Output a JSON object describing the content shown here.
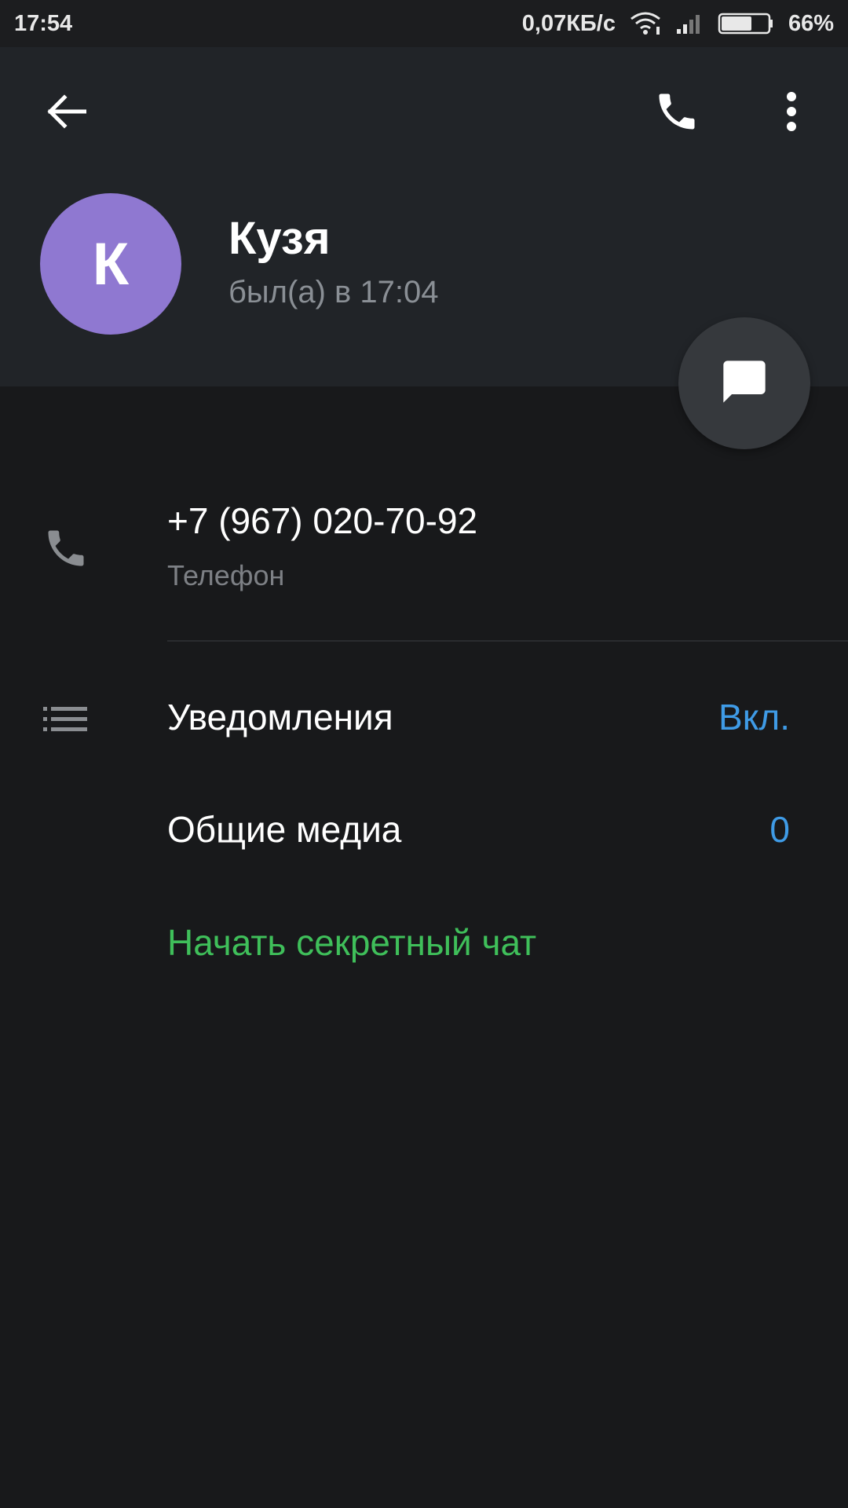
{
  "status_bar": {
    "time": "17:54",
    "network_speed": "0,07КБ/с",
    "battery": "66%",
    "battery_level": 0.66,
    "icons": [
      "wifi-icon",
      "signal-icon",
      "battery-icon"
    ]
  },
  "header": {
    "back_icon": "arrow-left-icon",
    "call_icon": "phone-icon",
    "more_icon": "more-vertical-icon",
    "avatar_letter": "К",
    "avatar_color": "#8f78d1",
    "name": "Кузя",
    "last_seen": "был(а) в 17:04",
    "fab_icon": "chat-bubble-icon"
  },
  "contact": {
    "phone_icon": "phone-icon",
    "phone": "+7 (967) 020-70-92",
    "phone_label": "Телефон"
  },
  "settings": {
    "list_icon": "list-icon",
    "notifications_label": "Уведомления",
    "notifications_value": "Вкл.",
    "media_label": "Общие медиа",
    "media_value": "0",
    "secret_chat_label": "Начать секретный чат"
  },
  "colors": {
    "background": "#18191b",
    "header": "#212428",
    "accent_blue": "#3f9be6",
    "accent_green": "#3fbf5a"
  }
}
